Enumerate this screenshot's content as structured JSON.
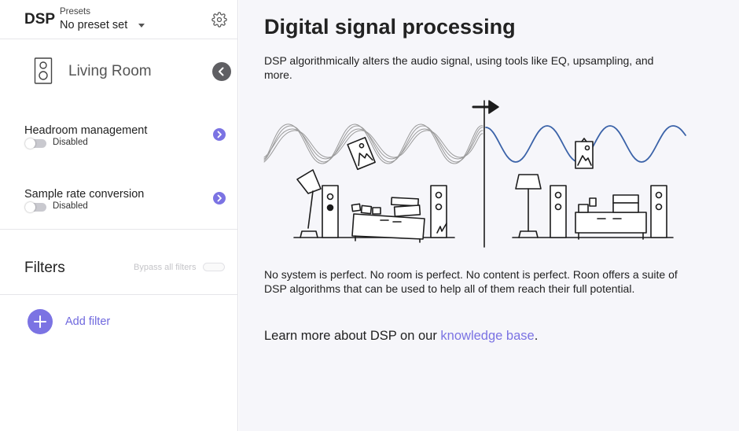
{
  "sidebar": {
    "title": "DSP",
    "presets_label": "Presets",
    "preset_value": "No preset set",
    "zone_name": "Living Room",
    "settings": [
      {
        "title": "Headroom management",
        "state": "Disabled"
      },
      {
        "title": "Sample rate conversion",
        "state": "Disabled"
      }
    ],
    "filters_title": "Filters",
    "bypass_label": "Bypass all filters",
    "add_filter_label": "Add filter",
    "accent_color": "#7b73e3"
  },
  "main": {
    "title": "Digital signal processing",
    "intro": "DSP algorithmically alters the audio signal, using tools like EQ, upsampling, and more.",
    "body": "No system is perfect. No room is perfect. No content is perfect. Roon offers a suite of DSP algorithms that can be used to help all of them reach their full potential.",
    "learn_prefix": "Learn more about DSP on our ",
    "learn_link": "knowledge base",
    "learn_suffix": ".",
    "wave_color": "#3a62a8"
  }
}
